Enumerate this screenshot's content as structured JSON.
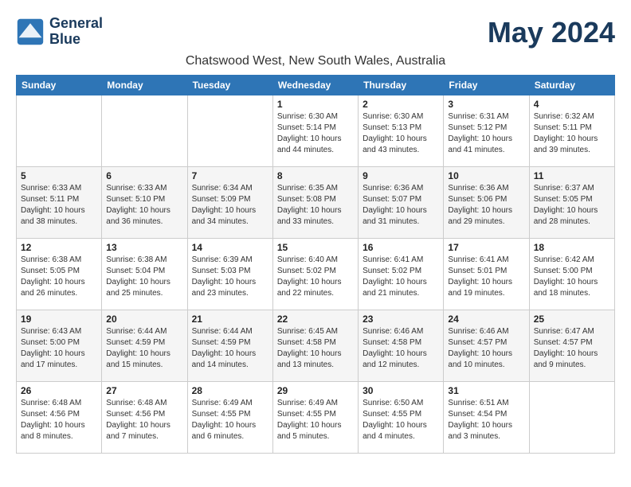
{
  "logo": {
    "line1": "General",
    "line2": "Blue"
  },
  "month_title": "May 2024",
  "location": "Chatswood West, New South Wales, Australia",
  "days_of_week": [
    "Sunday",
    "Monday",
    "Tuesday",
    "Wednesday",
    "Thursday",
    "Friday",
    "Saturday"
  ],
  "weeks": [
    [
      {
        "day": "",
        "info": ""
      },
      {
        "day": "",
        "info": ""
      },
      {
        "day": "",
        "info": ""
      },
      {
        "day": "1",
        "info": "Sunrise: 6:30 AM\nSunset: 5:14 PM\nDaylight: 10 hours\nand 44 minutes."
      },
      {
        "day": "2",
        "info": "Sunrise: 6:30 AM\nSunset: 5:13 PM\nDaylight: 10 hours\nand 43 minutes."
      },
      {
        "day": "3",
        "info": "Sunrise: 6:31 AM\nSunset: 5:12 PM\nDaylight: 10 hours\nand 41 minutes."
      },
      {
        "day": "4",
        "info": "Sunrise: 6:32 AM\nSunset: 5:11 PM\nDaylight: 10 hours\nand 39 minutes."
      }
    ],
    [
      {
        "day": "5",
        "info": "Sunrise: 6:33 AM\nSunset: 5:11 PM\nDaylight: 10 hours\nand 38 minutes."
      },
      {
        "day": "6",
        "info": "Sunrise: 6:33 AM\nSunset: 5:10 PM\nDaylight: 10 hours\nand 36 minutes."
      },
      {
        "day": "7",
        "info": "Sunrise: 6:34 AM\nSunset: 5:09 PM\nDaylight: 10 hours\nand 34 minutes."
      },
      {
        "day": "8",
        "info": "Sunrise: 6:35 AM\nSunset: 5:08 PM\nDaylight: 10 hours\nand 33 minutes."
      },
      {
        "day": "9",
        "info": "Sunrise: 6:36 AM\nSunset: 5:07 PM\nDaylight: 10 hours\nand 31 minutes."
      },
      {
        "day": "10",
        "info": "Sunrise: 6:36 AM\nSunset: 5:06 PM\nDaylight: 10 hours\nand 29 minutes."
      },
      {
        "day": "11",
        "info": "Sunrise: 6:37 AM\nSunset: 5:05 PM\nDaylight: 10 hours\nand 28 minutes."
      }
    ],
    [
      {
        "day": "12",
        "info": "Sunrise: 6:38 AM\nSunset: 5:05 PM\nDaylight: 10 hours\nand 26 minutes."
      },
      {
        "day": "13",
        "info": "Sunrise: 6:38 AM\nSunset: 5:04 PM\nDaylight: 10 hours\nand 25 minutes."
      },
      {
        "day": "14",
        "info": "Sunrise: 6:39 AM\nSunset: 5:03 PM\nDaylight: 10 hours\nand 23 minutes."
      },
      {
        "day": "15",
        "info": "Sunrise: 6:40 AM\nSunset: 5:02 PM\nDaylight: 10 hours\nand 22 minutes."
      },
      {
        "day": "16",
        "info": "Sunrise: 6:41 AM\nSunset: 5:02 PM\nDaylight: 10 hours\nand 21 minutes."
      },
      {
        "day": "17",
        "info": "Sunrise: 6:41 AM\nSunset: 5:01 PM\nDaylight: 10 hours\nand 19 minutes."
      },
      {
        "day": "18",
        "info": "Sunrise: 6:42 AM\nSunset: 5:00 PM\nDaylight: 10 hours\nand 18 minutes."
      }
    ],
    [
      {
        "day": "19",
        "info": "Sunrise: 6:43 AM\nSunset: 5:00 PM\nDaylight: 10 hours\nand 17 minutes."
      },
      {
        "day": "20",
        "info": "Sunrise: 6:44 AM\nSunset: 4:59 PM\nDaylight: 10 hours\nand 15 minutes."
      },
      {
        "day": "21",
        "info": "Sunrise: 6:44 AM\nSunset: 4:59 PM\nDaylight: 10 hours\nand 14 minutes."
      },
      {
        "day": "22",
        "info": "Sunrise: 6:45 AM\nSunset: 4:58 PM\nDaylight: 10 hours\nand 13 minutes."
      },
      {
        "day": "23",
        "info": "Sunrise: 6:46 AM\nSunset: 4:58 PM\nDaylight: 10 hours\nand 12 minutes."
      },
      {
        "day": "24",
        "info": "Sunrise: 6:46 AM\nSunset: 4:57 PM\nDaylight: 10 hours\nand 10 minutes."
      },
      {
        "day": "25",
        "info": "Sunrise: 6:47 AM\nSunset: 4:57 PM\nDaylight: 10 hours\nand 9 minutes."
      }
    ],
    [
      {
        "day": "26",
        "info": "Sunrise: 6:48 AM\nSunset: 4:56 PM\nDaylight: 10 hours\nand 8 minutes."
      },
      {
        "day": "27",
        "info": "Sunrise: 6:48 AM\nSunset: 4:56 PM\nDaylight: 10 hours\nand 7 minutes."
      },
      {
        "day": "28",
        "info": "Sunrise: 6:49 AM\nSunset: 4:55 PM\nDaylight: 10 hours\nand 6 minutes."
      },
      {
        "day": "29",
        "info": "Sunrise: 6:49 AM\nSunset: 4:55 PM\nDaylight: 10 hours\nand 5 minutes."
      },
      {
        "day": "30",
        "info": "Sunrise: 6:50 AM\nSunset: 4:55 PM\nDaylight: 10 hours\nand 4 minutes."
      },
      {
        "day": "31",
        "info": "Sunrise: 6:51 AM\nSunset: 4:54 PM\nDaylight: 10 hours\nand 3 minutes."
      },
      {
        "day": "",
        "info": ""
      }
    ]
  ]
}
